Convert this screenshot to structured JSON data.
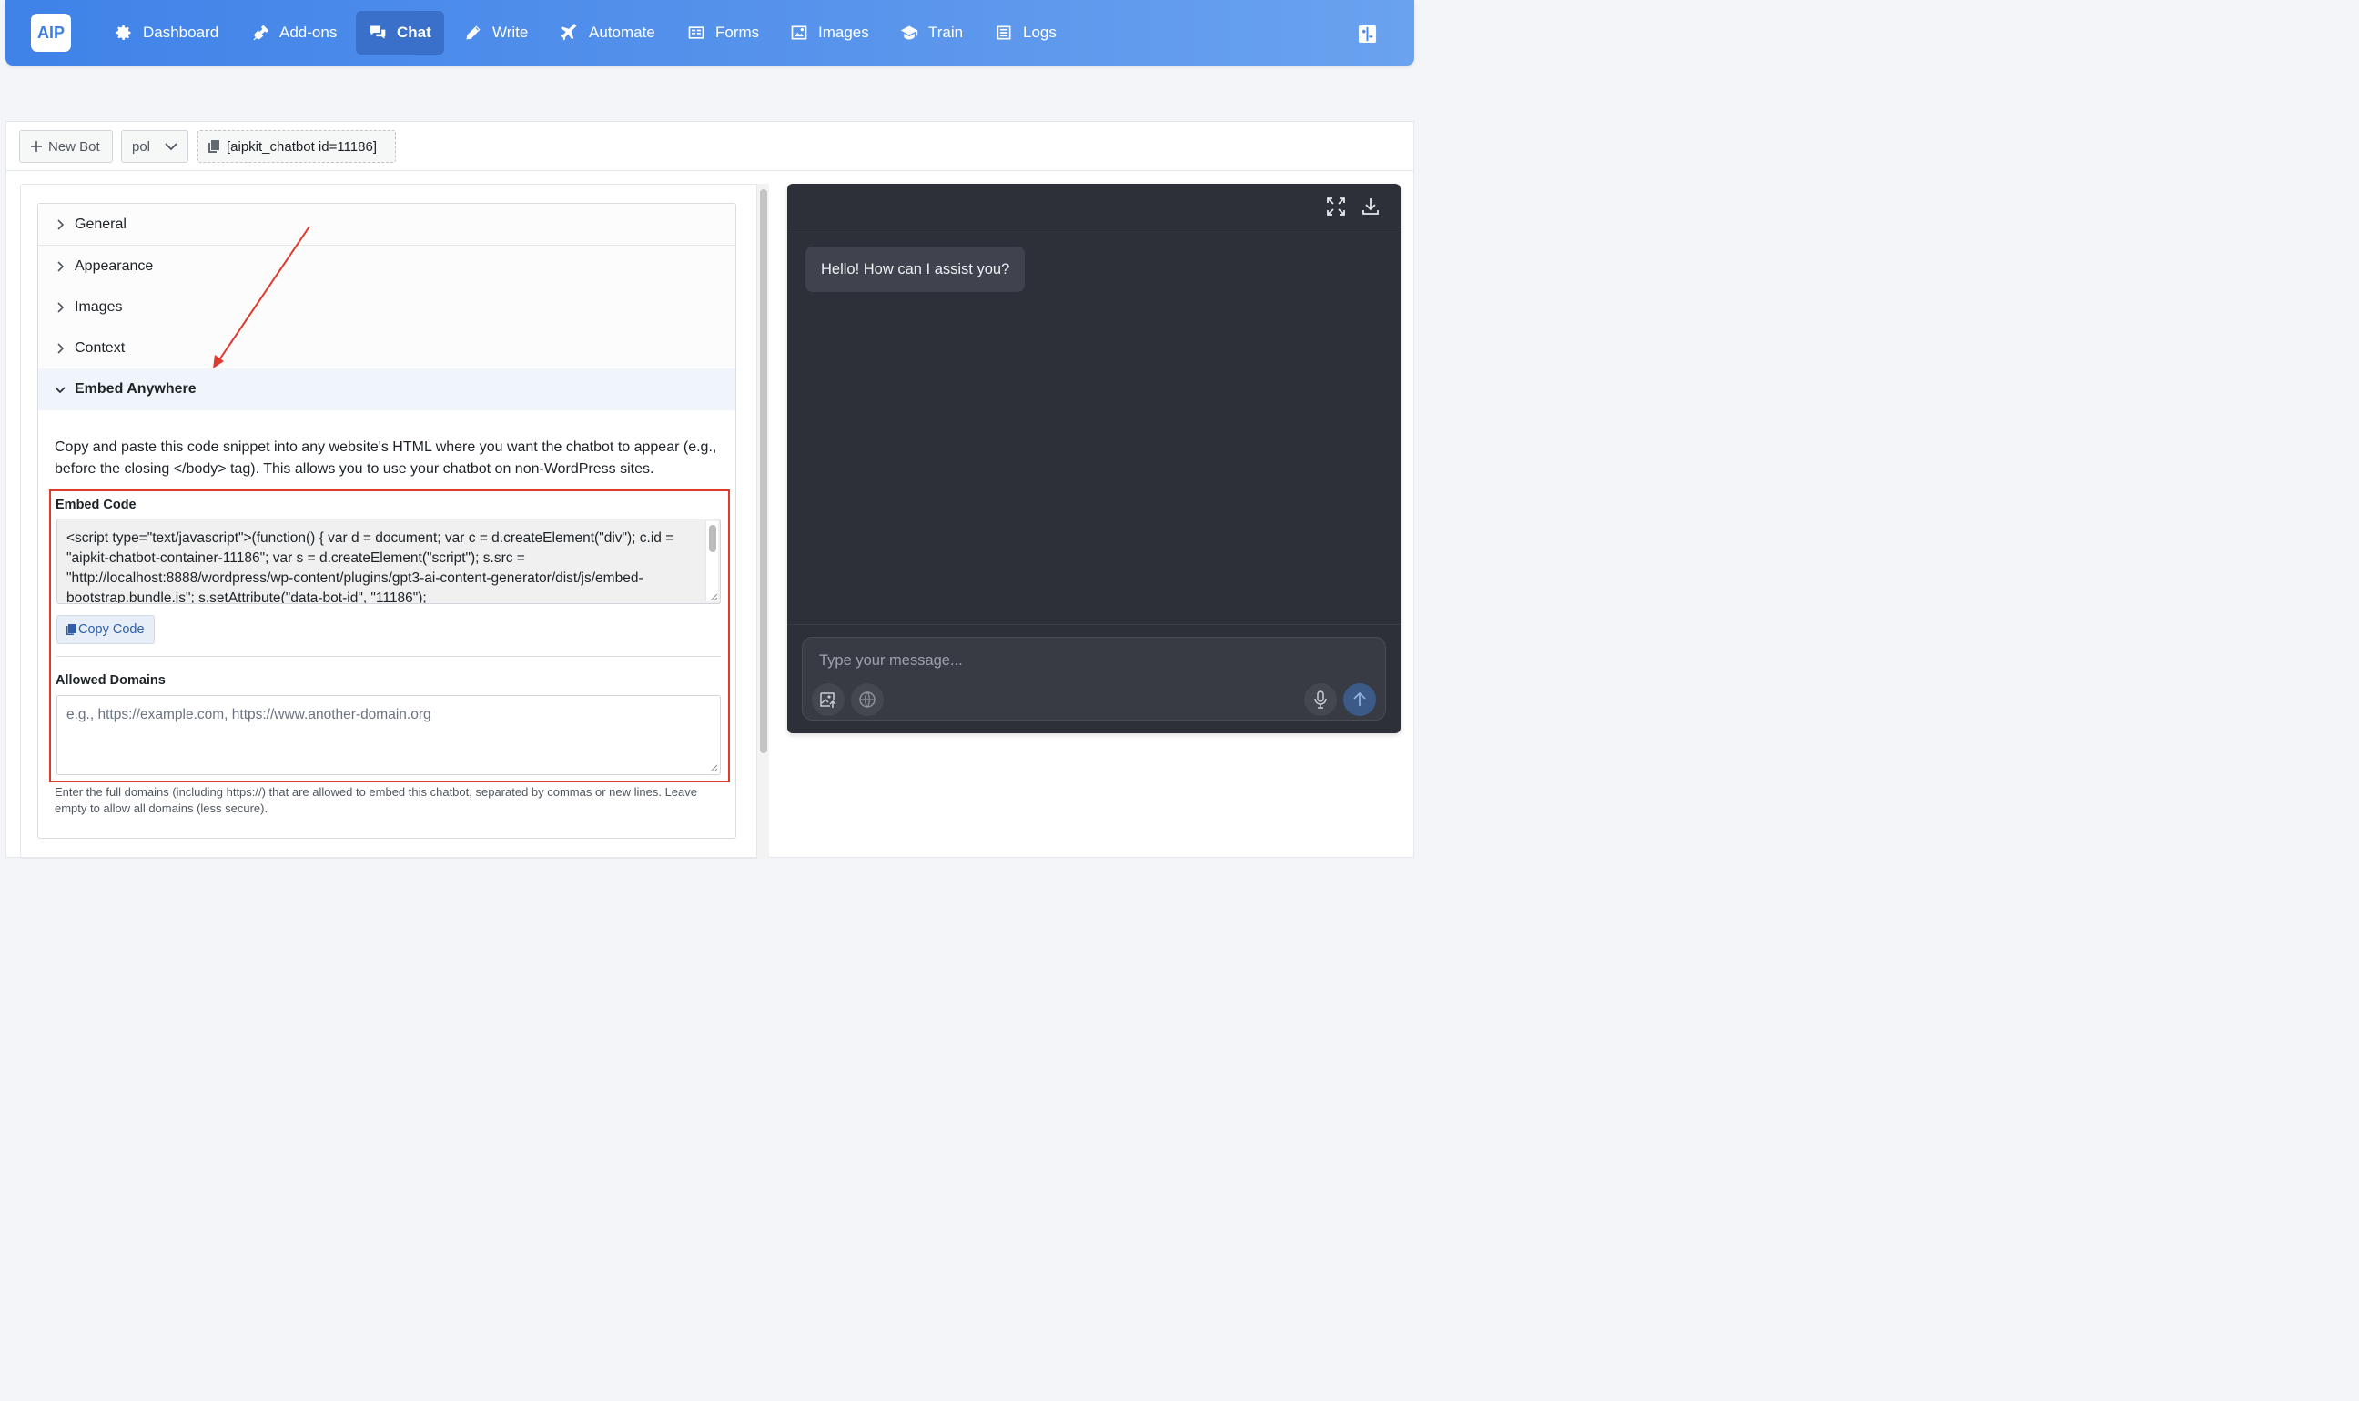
{
  "nav": {
    "logo": "AIP",
    "items": [
      {
        "label": "Dashboard",
        "icon": "gear-icon"
      },
      {
        "label": "Add-ons",
        "icon": "plug-icon"
      },
      {
        "label": "Chat",
        "icon": "chat-icon"
      },
      {
        "label": "Write",
        "icon": "pencil-icon"
      },
      {
        "label": "Automate",
        "icon": "plane-icon"
      },
      {
        "label": "Forms",
        "icon": "form-icon"
      },
      {
        "label": "Images",
        "icon": "image-icon"
      },
      {
        "label": "Train",
        "icon": "graduation-cap-icon"
      },
      {
        "label": "Logs",
        "icon": "list-icon"
      }
    ],
    "active": "Chat"
  },
  "toolbar": {
    "new_bot": "New Bot",
    "bot_select": "pol",
    "shortcode": "[aipkit_chatbot id=11186]"
  },
  "accordion": {
    "sections": [
      "General",
      "Appearance",
      "Images",
      "Context",
      "Embed Anywhere"
    ],
    "open_section": "Embed Anywhere"
  },
  "embed": {
    "description": "Copy and paste this code snippet into any website's HTML where you want the chatbot to appear (e.g., before the closing </body> tag). This allows you to use your chatbot on non-WordPress sites.",
    "code_label": "Embed Code",
    "code": "<script type=\"text/javascript\">(function() { var d = document; var c = d.createElement(\"div\"); c.id = \"aipkit-chatbot-container-11186\"; var s = d.createElement(\"script\"); s.src = \"http://localhost:8888/wordpress/wp-content/plugins/gpt3-ai-content-generator/dist/js/embed-bootstrap.bundle.js\"; s.setAttribute(\"data-bot-id\", \"11186\");",
    "copy_button": "Copy Code",
    "domains_label": "Allowed Domains",
    "domains_placeholder": "e.g., https://example.com, https://www.another-domain.org",
    "help": "Enter the full domains (including https://) that are allowed to embed this chatbot, separated by commas or new lines. Leave empty to allow all domains (less secure)."
  },
  "chat": {
    "greeting": "Hello! How can I assist you?",
    "input_placeholder": "Type your message..."
  },
  "colors": {
    "nav_gradient_start": "#3f82e8",
    "annotation_red": "#e03a2f",
    "chat_bg": "#2d3038"
  }
}
